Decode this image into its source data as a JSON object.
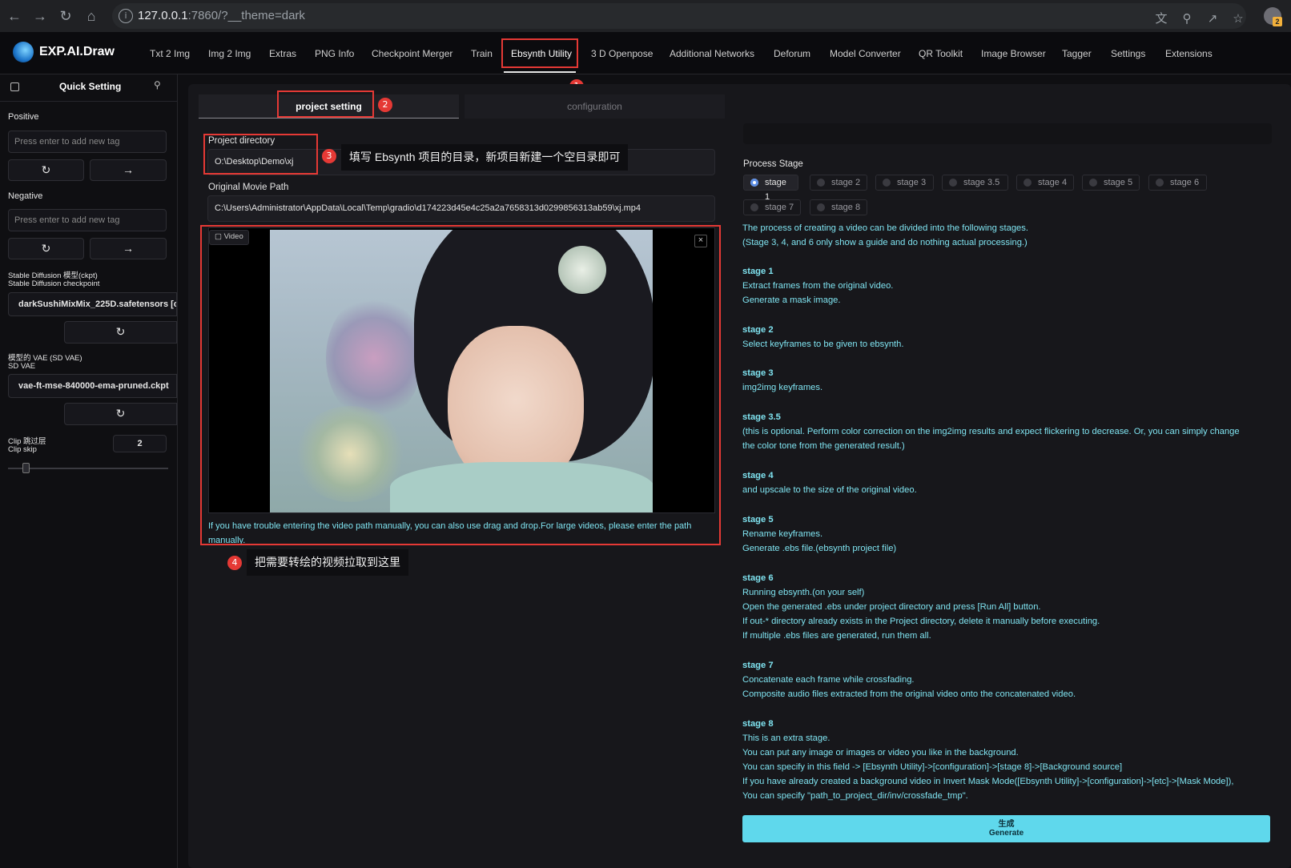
{
  "browser": {
    "url_host": "127.0.0.1",
    "url_rest": ":7860/?__theme=dark",
    "profile_badge": "2"
  },
  "app": {
    "brand": "EXP.AI.Draw",
    "tabs": [
      "Txt 2 Img",
      "Img 2 Img",
      "Extras",
      "PNG Info",
      "Checkpoint Merger",
      "Train",
      "Ebsynth Utility",
      "3 D Openpose",
      "Additional Networks",
      "Deforum",
      "Model Converter",
      "QR Toolkit",
      "Image Browser",
      "Tagger",
      "Settings",
      "Extensions"
    ],
    "active_tab": "Ebsynth Utility"
  },
  "sidebar": {
    "title": "Quick Setting",
    "positive_label": "Positive",
    "positive_placeholder": "Press enter to add new tag",
    "negative_label": "Negative",
    "negative_placeholder": "Press enter to add new tag",
    "ckpt_label_1": "Stable Diffusion 模型(ckpt)",
    "ckpt_label_2": "Stable Diffusion checkpoint",
    "ckpt_value": "darkSushiMixMix_225D.safetensors [cca",
    "vae_label_1": "模型的 VAE (SD VAE)",
    "vae_label_2": "SD VAE",
    "vae_value": "vae-ft-mse-840000-ema-pruned.ckpt",
    "clip_label_1": "Clip 跳过层",
    "clip_label_2": "Clip skip",
    "clip_value": "2"
  },
  "subtabs": {
    "project": "project setting",
    "config": "configuration"
  },
  "project": {
    "dir_label": "Project directory",
    "dir_value": "O:\\Desktop\\Demo\\xj",
    "movie_label": "Original Movie Path",
    "movie_value": "C:\\Users\\Administrator\\AppData\\Local\\Temp\\gradio\\d174223d45e4c25a2a7658313d0299856313ab59\\xj.mp4",
    "video_label": "Video",
    "hint_line1": "If you have trouble entering the video path manually, you can also use drag and drop.For large videos, please enter the path",
    "hint_line2": "manually."
  },
  "annotations": {
    "n1": "1",
    "n2": "2",
    "n3": "3",
    "n4": "4",
    "callout3": "填写 Ebsynth 项目的目录，新项目新建一个空目录即可",
    "callout4": "把需要转绘的视频拉取到这里"
  },
  "process": {
    "label": "Process Stage",
    "stages": [
      "stage 1",
      "stage 2",
      "stage 3",
      "stage 3.5",
      "stage 4",
      "stage 5",
      "stage 6",
      "stage 7",
      "stage 8"
    ],
    "selected": "stage 1",
    "lines": [
      {
        "t": "The process of creating a video can be divided into the following stages.",
        "b": false
      },
      {
        "t": "(Stage 3, 4, and 6 only show a guide and do nothing actual processing.)",
        "b": false
      },
      {
        "t": "stage 1",
        "b": true
      },
      {
        "t": "Extract frames from the original video.",
        "b": false
      },
      {
        "t": "Generate a mask image.",
        "b": false
      },
      {
        "t": "stage 2",
        "b": true
      },
      {
        "t": "Select keyframes to be given to ebsynth.",
        "b": false
      },
      {
        "t": "stage 3",
        "b": true
      },
      {
        "t": "img2img keyframes.",
        "b": false
      },
      {
        "t": "stage 3.5",
        "b": true
      },
      {
        "t": "(this is optional. Perform color correction on the img2img results and expect flickering to decrease. Or, you can simply change",
        "b": false
      },
      {
        "t": "the color tone from the generated result.)",
        "b": false
      },
      {
        "t": "stage 4",
        "b": true
      },
      {
        "t": "and upscale to the size of the original video.",
        "b": false
      },
      {
        "t": "stage 5",
        "b": true
      },
      {
        "t": "Rename keyframes.",
        "b": false
      },
      {
        "t": "Generate .ebs file.(ebsynth project file)",
        "b": false
      },
      {
        "t": "stage 6",
        "b": true
      },
      {
        "t": "Running ebsynth.(on your self)",
        "b": false
      },
      {
        "t": "Open the generated .ebs under project directory and press [Run All] button.",
        "b": false
      },
      {
        "t": "If out-* directory already exists in the Project directory, delete it manually before executing.",
        "b": false
      },
      {
        "t": "If multiple .ebs files are generated, run them all.",
        "b": false
      },
      {
        "t": "stage 7",
        "b": true
      },
      {
        "t": "Concatenate each frame while crossfading.",
        "b": false
      },
      {
        "t": "Composite audio files extracted from the original video onto the concatenated video.",
        "b": false
      },
      {
        "t": "stage 8",
        "b": true
      },
      {
        "t": "This is an extra stage.",
        "b": false
      },
      {
        "t": "You can put any image or images or video you like in the background.",
        "b": false
      },
      {
        "t": "You can specify in this field -> [Ebsynth Utility]->[configuration]->[stage 8]->[Background source]",
        "b": false
      },
      {
        "t": "If you have already created a background video in Invert Mask Mode([Ebsynth Utility]->[configuration]->[etc]->[Mask Mode]),",
        "b": false
      },
      {
        "t": "You can specify \"path_to_project_dir/inv/crossfade_tmp\".",
        "b": false
      }
    ],
    "generate_cn": "生成",
    "generate_en": "Generate"
  }
}
